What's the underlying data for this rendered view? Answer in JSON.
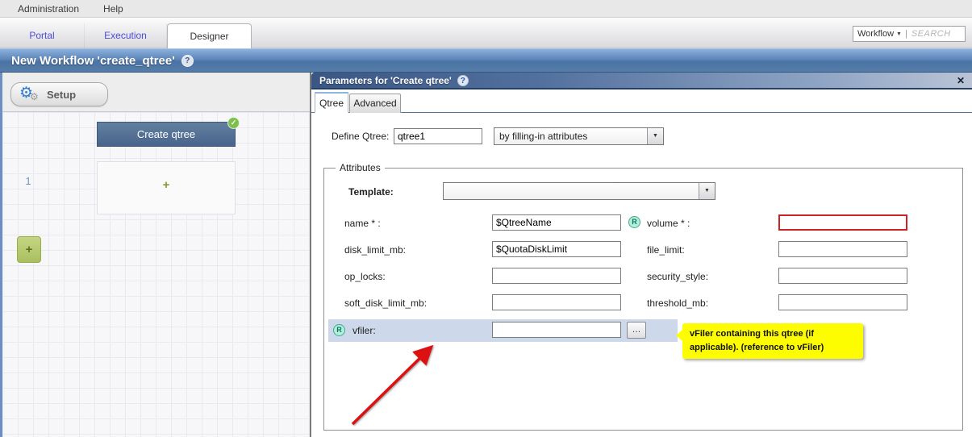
{
  "icons": {
    "help": "?",
    "close": "✕",
    "dropdown": "▼",
    "gear": "⚙",
    "check": "✓",
    "browse": "…",
    "divider": "|"
  },
  "menubar": {
    "items": [
      {
        "label": "Administration"
      },
      {
        "label": "Help"
      }
    ]
  },
  "topbar": {
    "tabs": [
      {
        "label": "Portal"
      },
      {
        "label": "Execution"
      },
      {
        "label": "Designer"
      }
    ],
    "workflow_label": "Workflow",
    "search_placeholder": "SEARCH"
  },
  "titlebar": {
    "title": "New Workflow 'create_qtree'"
  },
  "canvas": {
    "setup_label": "Setup",
    "node_title": "Create qtree",
    "row_number": "1",
    "plus": "+"
  },
  "dialog": {
    "title": "Parameters for 'Create qtree'",
    "tabs": [
      {
        "label": "Qtree"
      },
      {
        "label": "Advanced"
      }
    ],
    "define": {
      "label": "Define Qtree:",
      "value": "qtree1",
      "mode": "by filling-in attributes"
    },
    "attributes": {
      "legend": "Attributes",
      "template": {
        "label": "Template:",
        "value": ""
      },
      "rows": [
        {
          "left": {
            "label": "name * :",
            "value": "$QtreeName"
          },
          "right": {
            "badge": "R",
            "label": "volume * :",
            "value": ""
          }
        },
        {
          "left": {
            "label": "disk_limit_mb:",
            "value": "$QuotaDiskLimit"
          },
          "right": {
            "label": "file_limit:",
            "value": ""
          }
        },
        {
          "left": {
            "label": "op_locks:",
            "value": ""
          },
          "right": {
            "label": "security_style:",
            "value": ""
          }
        },
        {
          "left": {
            "label": "soft_disk_limit_mb:",
            "value": ""
          },
          "right": {
            "label": "threshold_mb:",
            "value": ""
          }
        }
      ],
      "vfiler": {
        "badge": "R",
        "label": "vfiler:",
        "value": "",
        "browse": "…"
      },
      "tooltip": "vFiler containing this qtree (if applicable). (reference to vFiler)"
    }
  },
  "colors": {
    "accent_blue": "#4a72a4",
    "dialog_header_blue": "#3a5784",
    "tooltip_yellow": "#fdfd00",
    "error_red": "#cc2222",
    "arrow_red": "#dd1111",
    "node_blue": "#52719b",
    "badge_green": "#7dbf4d",
    "reference_teal": "#49a58f",
    "add_button_green": "#aabf60"
  }
}
